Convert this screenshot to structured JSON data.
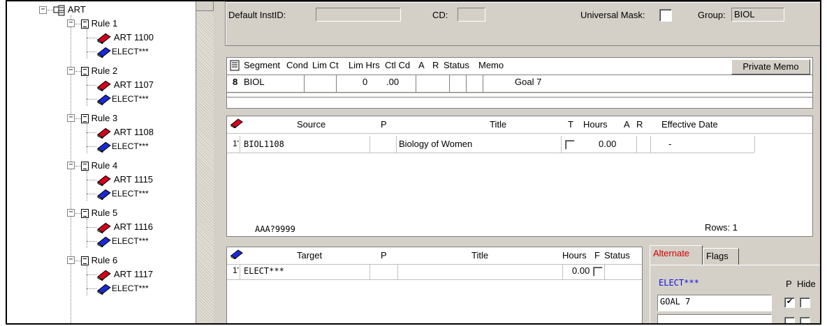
{
  "tree": {
    "root": "ART",
    "rules": [
      {
        "label": "Rule 1",
        "source": "ART 1100",
        "target": "ELECT***"
      },
      {
        "label": "Rule 2",
        "source": "ART 1107",
        "target": "ELECT***"
      },
      {
        "label": "Rule 3",
        "source": "ART 1108",
        "target": "ELECT***"
      },
      {
        "label": "Rule 4",
        "source": "ART 1115",
        "target": "ELECT***"
      },
      {
        "label": "Rule 5",
        "source": "ART 1116",
        "target": "ELECT***"
      },
      {
        "label": "Rule 6",
        "source": "ART 1117",
        "target": "ELECT***"
      }
    ]
  },
  "header": {
    "default_instid_label": "Default InstID:",
    "default_instid_value": "",
    "cd_label": "CD:",
    "cd_value": "",
    "universal_mask_label": "Universal Mask:",
    "group_label": "Group:",
    "group_value": "BIOL"
  },
  "segment_grid": {
    "headers": [
      "Segment",
      "Cond",
      "Lim Ct",
      "Lim Hrs",
      "Ctl Cd",
      "A",
      "R",
      "Status",
      "Memo"
    ],
    "private_memo_button": "Private Memo",
    "row": {
      "num": "8",
      "segment": "BIOL",
      "cond": "",
      "lim_ct": "0",
      "lim_hrs": ".00",
      "ctl_cd": "",
      "a": "",
      "r": "",
      "status": "",
      "memo": "Goal 7"
    }
  },
  "source_grid": {
    "headers": {
      "source": "Source",
      "p": "P",
      "title": "Title",
      "t": "T",
      "hours": "Hours",
      "a": "A",
      "r": "R",
      "effective_date": "Effective Date"
    },
    "row": {
      "num": "1'",
      "source": "BIOL1108",
      "p": "",
      "title": "Biology of Women",
      "hours": "0.00",
      "effective_date": "-"
    },
    "footer_mask": "AAA?9999",
    "rows_count": "Rows: 1"
  },
  "target_grid": {
    "headers": {
      "target": "Target",
      "p": "P",
      "title": "Title",
      "hours": "Hours",
      "f": "F",
      "status": "Status"
    },
    "row": {
      "num": "1'",
      "target": "ELECT***",
      "p": "",
      "title": "",
      "hours": "0.00"
    }
  },
  "tabs": {
    "alternate": "Alternate",
    "flags": "Flags",
    "alt_heading": "ELECT***",
    "p_label": "P",
    "hide_label": "Hide",
    "alt_value": "GOAL 7",
    "alt_p_checked": true
  },
  "colors": {
    "source_book": "#d8001c",
    "target_book": "#1a2ad8",
    "alt_heading": "#1010e0",
    "alternate_tab": "#d00000"
  }
}
